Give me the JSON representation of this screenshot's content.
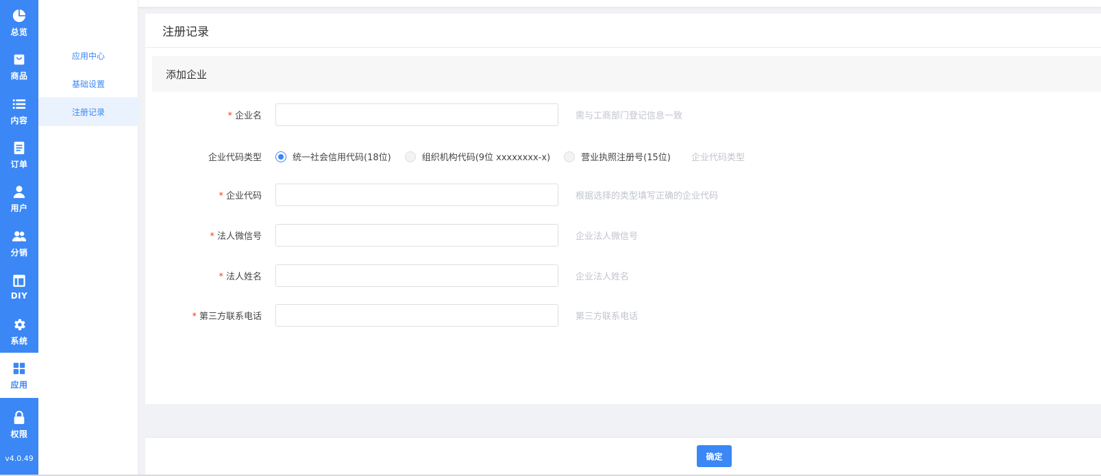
{
  "rail": {
    "items": [
      {
        "label": "总览",
        "icon": "pie-chart-icon"
      },
      {
        "label": "商品",
        "icon": "shopping-bag-icon"
      },
      {
        "label": "内容",
        "icon": "list-icon"
      },
      {
        "label": "订单",
        "icon": "document-icon"
      },
      {
        "label": "用户",
        "icon": "user-icon"
      },
      {
        "label": "分销",
        "icon": "users-icon"
      },
      {
        "label": "DIY",
        "icon": "layout-icon"
      },
      {
        "label": "系统",
        "icon": "gear-icon"
      },
      {
        "label": "应用",
        "icon": "grid-icon"
      },
      {
        "label": "权限",
        "icon": "lock-icon"
      }
    ],
    "version": "v4.0.49"
  },
  "submenu": {
    "items": [
      {
        "label": "应用中心"
      },
      {
        "label": "基础设置"
      },
      {
        "label": "注册记录"
      }
    ]
  },
  "card": {
    "title": "注册记录",
    "section_title": "添加企业"
  },
  "form": {
    "company_name": {
      "label": "企业名",
      "value": "",
      "hint": "需与工商部门登记信息一致"
    },
    "code_type": {
      "label": "企业代码类型",
      "options": [
        {
          "label": "统一社会信用代码(18位)"
        },
        {
          "label": "组织机构代码(9位 xxxxxxxx-x)"
        },
        {
          "label": "营业执照注册号(15位)"
        }
      ],
      "selected": "统一社会信用代码(18位)",
      "hint": "企业代码类型"
    },
    "company_code": {
      "label": "企业代码",
      "value": "",
      "hint": "根据选择的类型填写正确的企业代码"
    },
    "legal_wechat": {
      "label": "法人微信号",
      "value": "",
      "hint": "企业法人微信号"
    },
    "legal_name": {
      "label": "法人姓名",
      "value": "",
      "hint": "企业法人姓名"
    },
    "third_phone": {
      "label": "第三方联系电话",
      "value": "",
      "hint": "第三方联系电话"
    }
  },
  "footer": {
    "confirm_label": "确定"
  },
  "colors": {
    "primary": "#3a87f5",
    "required": "#ed4014",
    "hint": "#c0c4cc"
  }
}
